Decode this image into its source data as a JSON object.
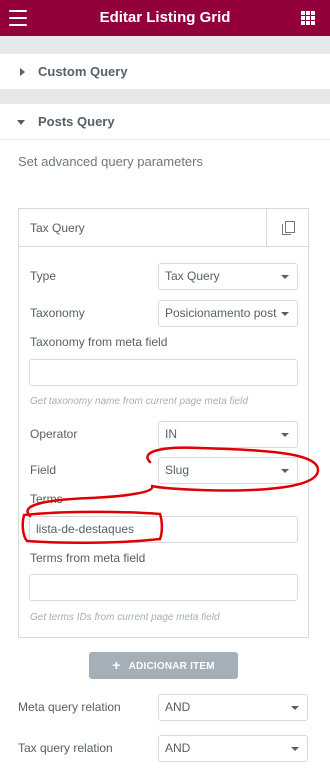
{
  "header": {
    "title": "Editar Listing Grid",
    "menu_icon": "hamburger-icon",
    "apps_icon": "grid-icon"
  },
  "sections": {
    "custom_query": {
      "label": "Custom Query",
      "state": "collapsed"
    },
    "posts_query": {
      "label": "Posts Query",
      "state": "expanded",
      "description": "Set advanced query parameters"
    }
  },
  "tax_query_item": {
    "title": "Tax Query",
    "type": {
      "label": "Type",
      "value": "Tax Query"
    },
    "taxonomy": {
      "label": "Taxonomy",
      "value": "Posicionamento post"
    },
    "taxonomy_meta": {
      "label": "Taxonomy from meta field",
      "value": "",
      "hint": "Get taxonomy name from current page meta field"
    },
    "operator": {
      "label": "Operator",
      "value": "IN"
    },
    "field": {
      "label": "Field",
      "value": "Slug"
    },
    "terms": {
      "label": "Terms",
      "value": "lista-de-destaques"
    },
    "terms_meta": {
      "label": "Terms from meta field",
      "value": "",
      "hint": "Get terms IDs from current page meta field"
    }
  },
  "add_item_button": {
    "label": "ADICIONAR ITEM",
    "icon": "+"
  },
  "meta_query_relation": {
    "label": "Meta query relation",
    "value": "AND"
  },
  "tax_query_relation": {
    "label": "Tax query relation",
    "value": "AND"
  },
  "annotation_color": "#e00000",
  "colors": {
    "header_bg": "#93003c",
    "button_bg": "#a4afb7"
  }
}
